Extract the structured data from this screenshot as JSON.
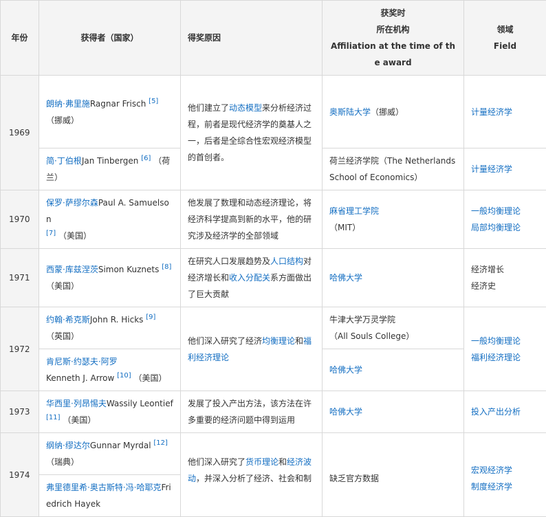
{
  "headers": {
    "year": "年份",
    "laureate": "获得者（国家）",
    "reason": "得奖原因",
    "affil_l1": "获奖时",
    "affil_l2": "所在机构",
    "affil_en": "Affiliation at the time of the award",
    "field_l1": "领域",
    "field_en": "Field"
  },
  "rows": [
    {
      "year": "1969",
      "reason": {
        "t1": "他们建立了",
        "link1": "动态模型",
        "t2": "来分析经济过程，前者是现代经济学的奠基人之一，后者是全综合性宏观经济模型的首创者。"
      },
      "laureates": [
        {
          "name_link": "朗纳·弗里施",
          "name_en": "Ragnar Frisch",
          "ref": "[5]",
          "country": "（挪威）",
          "affiliation_link": "奥斯陆大学",
          "affiliation_text": "（挪威）",
          "field": "计量经济学"
        },
        {
          "name_link": "简·丁伯根",
          "name_en": "Jan Tinbergen",
          "ref": "[6]",
          "country": "（荷兰）",
          "affiliation_text": "荷兰经济学院（The Netherlands School of Economics）",
          "field": "计量经济学"
        }
      ]
    },
    {
      "year": "1970",
      "reason": "他发展了数理和动态经济理论，将经济科学提高到新的水平，他的研究涉及经济学的全部领域",
      "name_link": "保罗·萨缪尔森",
      "name_en": "Paul A. Samuelson",
      "ref": "[7]",
      "country": "（美国）",
      "affiliation_link": "麻省理工学院",
      "affiliation_text": "（MIT）",
      "fields": [
        "一般均衡理论",
        "局部均衡理论"
      ]
    },
    {
      "year": "1971",
      "reason": {
        "t1": "在研究人口发展趋势及",
        "link1": "人口结构",
        "t2": "对经济增长和",
        "link2": "收入分配关",
        "t3": "系方面做出了巨大贡献"
      },
      "name_link": "西蒙·库兹涅茨",
      "name_en": "Simon Kuznets",
      "ref": "[8]",
      "country": "（美国）",
      "affiliation_link": "哈佛大学",
      "fields": [
        "经济增长",
        "经济史"
      ]
    },
    {
      "year": "1972",
      "reason": {
        "t1": "他们深入研究了经济",
        "link1": "均衡理论",
        "t2": "和",
        "link2": "福利经济理论"
      },
      "fields": [
        "一般均衡理论",
        "福利经济理论"
      ],
      "laureates": [
        {
          "name_link": "约翰·希克斯",
          "name_en": "John R. Hicks",
          "ref": "[9]",
          "country": "（英国）",
          "affiliation_text": "牛津大学万灵学院",
          "affiliation_text2": "（All Souls College）"
        },
        {
          "name_link": "肯尼斯·约瑟夫·阿罗",
          "name_en": "Kenneth J. Arrow",
          "ref": "[10]",
          "country": "（美国）",
          "affiliation_link": "哈佛大学"
        }
      ]
    },
    {
      "year": "1973",
      "reason": "发展了投入产出方法，该方法在许多重要的经济问题中得到运用",
      "name_link": "华西里·列昂惕夫",
      "name_en": "Wassily Leontief",
      "ref": "[11]",
      "country": "（美国）",
      "affiliation_link": "哈佛大学",
      "field": "投入产出分析"
    },
    {
      "year": "1974",
      "reason": {
        "t1": "他们深入研究了",
        "link1": "货币理论",
        "t2": "和",
        "link2": "经济波动",
        "t3": "，并深入分析了经济、社会和制"
      },
      "affiliation_text": "缺乏官方数据",
      "fields": [
        "宏观经济学",
        "制度经济学"
      ],
      "laureates": [
        {
          "name_link": "纲纳·缪达尔",
          "name_en": "Gunnar Myrdal",
          "ref": "[12]",
          "country": "（瑞典）"
        },
        {
          "name_link": "弗里德里希·奥古斯特·冯·哈耶克",
          "name_en": "Friedrich Hayek"
        }
      ]
    }
  ],
  "colors": {
    "link": "#136ec2",
    "text": "#333333",
    "header_bg": "#f4f4f4",
    "border": "#d8d8d8"
  }
}
